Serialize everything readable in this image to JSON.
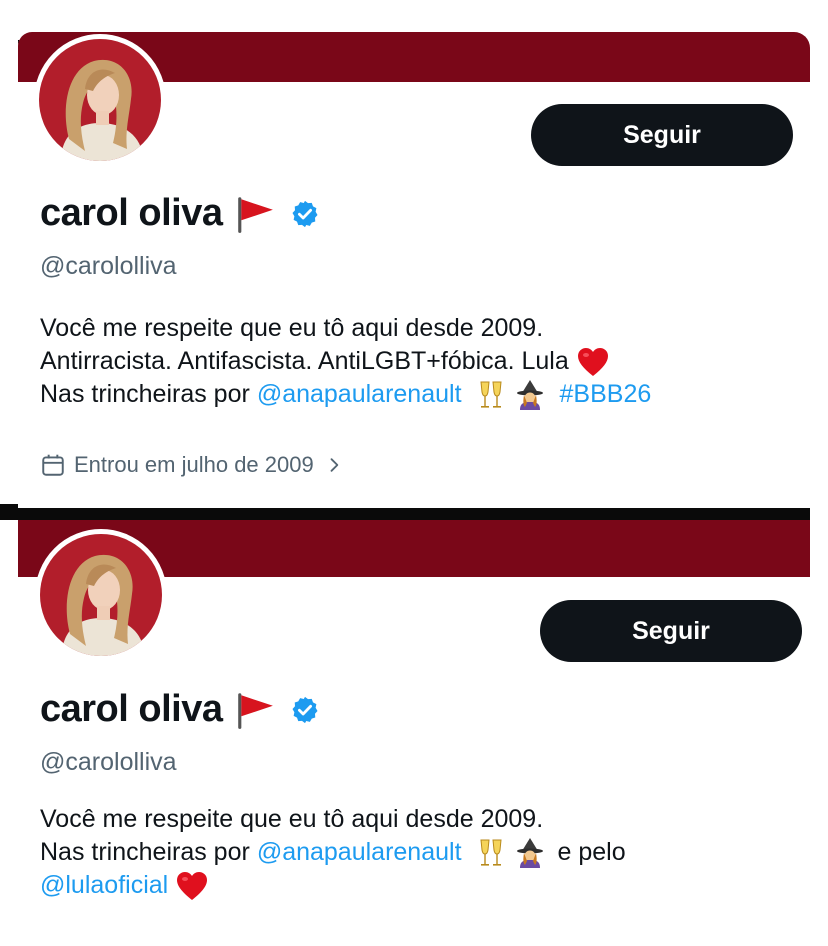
{
  "colors": {
    "banner": "#7a0718",
    "link": "#1d9bf0",
    "secondary_text": "#536471",
    "button_bg": "#0f1419"
  },
  "profile_top": {
    "follow_label": "Seguir",
    "name": "carol oliva",
    "name_icons": [
      "red-flag-icon",
      "verified-badge-icon"
    ],
    "handle": "@carololliva",
    "bio": {
      "line1": "Você me respeite que eu tô aqui desde 2009.",
      "line2": "Antirracista. Antifascista. AntiLGBT+fóbica. Lula",
      "line2_icon": "red-heart-icon",
      "line3_prefix": "Nas trincheiras por",
      "line3_mention": "@anapaularenault",
      "line3_icons": [
        "champagne-glasses-icon",
        "witch-icon"
      ],
      "line3_hashtag": "#BBB26"
    },
    "joined_icon": "calendar-icon",
    "joined_text": "Entrou em julho de 2009"
  },
  "profile_bottom": {
    "follow_label": "Seguir",
    "name": "carol oliva",
    "name_icons": [
      "red-flag-icon",
      "verified-badge-icon"
    ],
    "handle": "@carololliva",
    "bio": {
      "line1": "Você me respeite que eu tô aqui desde 2009.",
      "line2_prefix": "Nas trincheiras por",
      "line2_mention": "@anapaularenault",
      "line2_icons": [
        "champagne-glasses-icon",
        "witch-icon"
      ],
      "line2_suffix": "e pelo",
      "line3_mention": "@lulaoficial",
      "line3_icon": "red-heart-icon"
    }
  }
}
